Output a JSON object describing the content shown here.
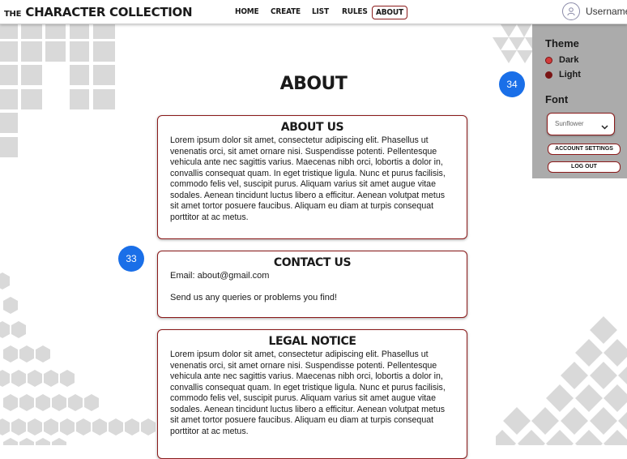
{
  "header": {
    "brand_prefix": "THE",
    "brand_main": "CHARACTER COLLECTION",
    "nav": [
      "HOME",
      "CREATE",
      "LIST",
      "RULES",
      "ABOUT"
    ],
    "active_nav": "ABOUT",
    "username": "Username"
  },
  "settings_panel": {
    "theme_title": "Theme",
    "theme_options": [
      "Dark",
      "Light"
    ],
    "selected_theme": "Dark",
    "font_title": "Font",
    "font_value": "Sunflower",
    "account_settings_label": "ACCOUNT SETTINGS",
    "logout_label": "LOG OUT"
  },
  "page": {
    "title": "ABOUT",
    "about_us": {
      "title": "ABOUT US",
      "body": "Lorem ipsum dolor sit amet, consectetur adipiscing elit. Phasellus ut venenatis orci, sit amet ornare nisi. Suspendisse potenti. Pellentesque vehicula ante nec sagittis varius. Maecenas nibh orci, lobortis a dolor in, convallis consequat quam. In eget tristique ligula. Nunc et purus facilisis, commodo felis vel, suscipit purus. Aliquam varius sit amet augue vitae sodales. Aenean tincidunt luctus libero a efficitur. Aenean volutpat metus sit amet tortor posuere faucibus. Aliquam eu diam at turpis consequat porttitor at ac metus."
    },
    "contact": {
      "title": "CONTACT US",
      "email": "Email: about@gmail.com",
      "note": "Send us any queries or problems you find!"
    },
    "legal": {
      "title": "LEGAL NOTICE",
      "body": "Lorem ipsum dolor sit amet, consectetur adipiscing elit. Phasellus ut venenatis orci, sit amet ornare nisi. Suspendisse potenti. Pellentesque vehicula ante nec sagittis varius. Maecenas nibh orci, lobortis a dolor in, convallis consequat quam. In eget tristique ligula. Nunc et purus facilisis, commodo felis vel, suscipit purus. Aliquam varius sit amet augue vitae sodales. Aenean tincidunt luctus libero a efficitur. Aenean volutpat metus sit amet tortor posuere faucibus. Aliquam eu diam at turpis consequat porttitor at ac metus."
    }
  },
  "badges": {
    "panel_badge": "34",
    "contact_badge": "33"
  },
  "colors": {
    "accent": "#8b1a1a",
    "badge": "#1a6fe8",
    "panel": "#ababab",
    "pattern": "#d9d9d9"
  },
  "icons": {
    "avatar": "user-icon",
    "select": "chevron-down-icon"
  }
}
